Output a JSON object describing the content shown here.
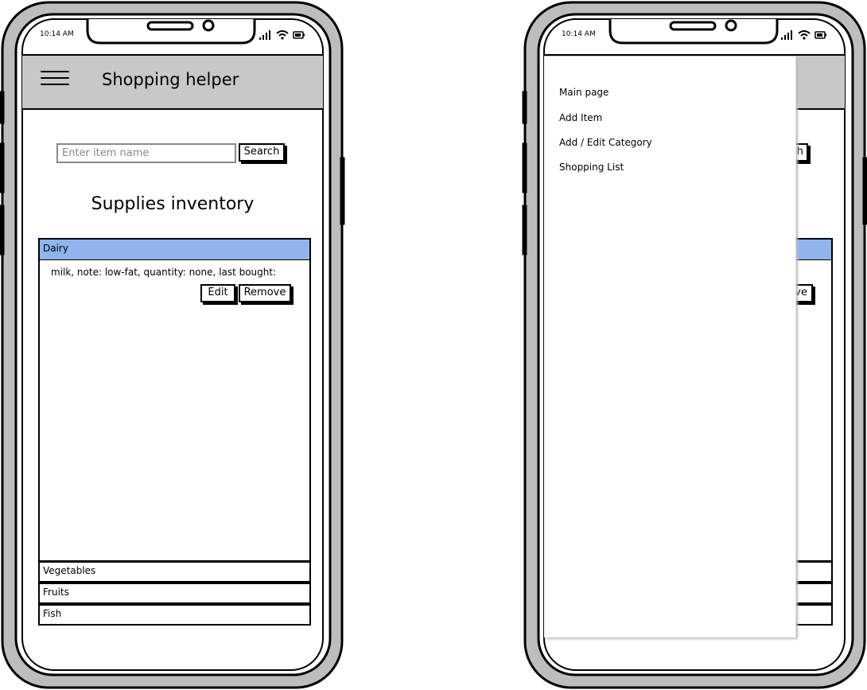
{
  "left_phone": {
    "status": {
      "time": "10:14 AM"
    },
    "header": {
      "title": "Shopping helper"
    },
    "search": {
      "placeholder": "Enter item name",
      "button_label": "Search"
    },
    "page_title": "Supplies inventory",
    "categories": [
      {
        "label": "Dairy",
        "expanded": true
      },
      {
        "label": "Vegetables",
        "expanded": false
      },
      {
        "label": "Fruits",
        "expanded": false
      },
      {
        "label": "Fish",
        "expanded": false
      }
    ],
    "item": {
      "text": "milk, note: low-fat, quantity: none, last bought:",
      "edit_label": "Edit",
      "remove_label": "Remove"
    },
    "colors": {
      "header_bg": "#c8c8c8",
      "selected_category": "#8fb4ee"
    }
  },
  "right_phone": {
    "status": {
      "time": "10:14 AM"
    },
    "menu": {
      "items": [
        "Main page",
        "Add Item",
        "Add / Edit Category",
        "Shopping List"
      ]
    },
    "partial_visible": {
      "search_fragment": "h",
      "remove_fragment": "ve"
    }
  }
}
